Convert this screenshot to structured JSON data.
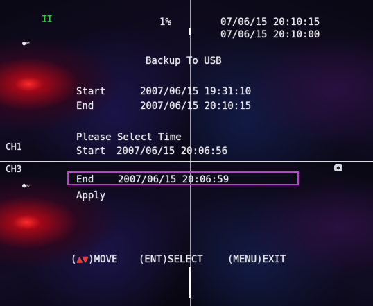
{
  "status": {
    "record_indicator": "II",
    "storage_used": "1%",
    "datetime_current": "07/06/15 20:10:15",
    "datetime_playback": "07/06/15 20:10:00"
  },
  "channels": {
    "ch1_label": "CH1",
    "ch3_label": "CH3"
  },
  "dialog": {
    "title": "Backup To USB",
    "range_start_label": "Start",
    "range_start_value": "2007/06/15 19:31:10",
    "range_end_label": "End",
    "range_end_value": "2007/06/15 20:10:15",
    "prompt": "Please Select Time",
    "select_start_label": "Start",
    "select_start_value": "2007/06/15 20:06:56",
    "select_end_label": "End",
    "select_end_value": "2007/06/15 20:06:59",
    "apply_label": "Apply"
  },
  "help": {
    "move": ")MOVE",
    "select": "(ENT)SELECT",
    "exit": "(MENU)EXIT"
  },
  "colors": {
    "selection_border": "#c43bd6",
    "record_indicator": "#2ecc40",
    "move_arrows": "#ff3030"
  }
}
